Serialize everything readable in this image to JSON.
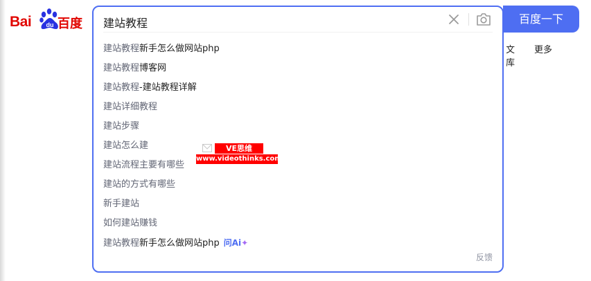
{
  "logo": {
    "latin": "Bai",
    "paw_text": "du",
    "chinese": "百度"
  },
  "search": {
    "query": "建站教程",
    "button_label": "百度一下",
    "feedback_label": "反馈"
  },
  "suggestions": [
    {
      "prefix": "建站教程",
      "rest": "新手怎么做网站php"
    },
    {
      "prefix": "建站教程",
      "rest": "博客网"
    },
    {
      "prefix": "建站教程",
      "rest": "-建站教程详解"
    },
    {
      "prefix": "建站详细教程",
      "rest": ""
    },
    {
      "prefix": "建站步骤",
      "rest": ""
    },
    {
      "prefix": "建站怎么建",
      "rest": ""
    },
    {
      "prefix": "建站流程主要有哪些",
      "rest": ""
    },
    {
      "prefix": "建站的方式有哪些",
      "rest": ""
    },
    {
      "prefix": "新手建站",
      "rest": ""
    },
    {
      "prefix": "如何建站赚钱",
      "rest": ""
    },
    {
      "prefix": "建站教程",
      "rest": "新手怎么做网站php",
      "ai_label": "问Ai"
    }
  ],
  "nav": {
    "wenku_partial": "文库",
    "more": "更多"
  },
  "watermark": {
    "line1": "VE思维",
    "line2": "www.videothinks.com"
  },
  "colors": {
    "brand_red": "#e10601",
    "accent_blue": "#4e6ef2",
    "suggestion_gray": "#626675"
  }
}
